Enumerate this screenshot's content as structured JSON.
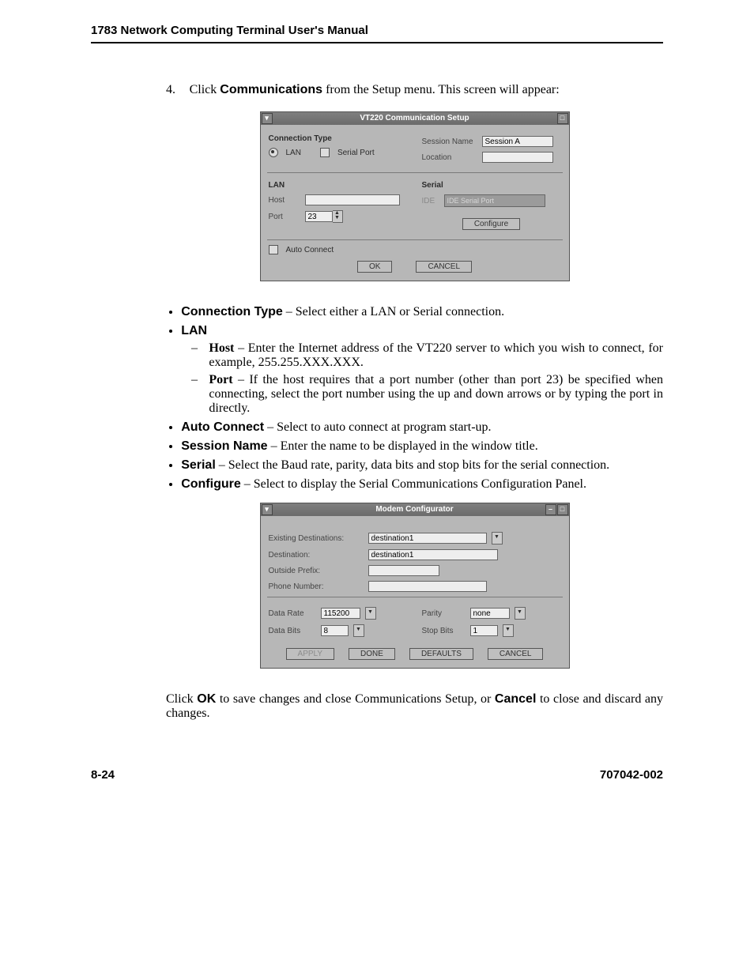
{
  "header": {
    "running": "1783 Network Computing Terminal User's Manual"
  },
  "step": {
    "number": "4.",
    "pre": "Click ",
    "bold": "Communications",
    "post": " from the Setup menu. This screen will appear:"
  },
  "win1": {
    "title": "VT220 Communication Setup",
    "conn_type_label": "Connection Type",
    "radio_lan": "LAN",
    "radio_serial": "Serial Port",
    "session_name_label": "Session Name",
    "session_name_value": "Session A",
    "location_label": "Location",
    "lan_label": "LAN",
    "host_label": "Host",
    "port_label": "Port",
    "port_value": "23",
    "serial_label": "Serial",
    "serial_field_label": "IDE",
    "serial_field_value": "IDE Serial Port",
    "configure_btn": "Configure",
    "auto_connect": "Auto Connect",
    "ok": "OK",
    "cancel": "CANCEL"
  },
  "bullets": {
    "b1_bold": "Connection Type",
    "b1_rest": " – Select either a LAN or Serial connection.",
    "b2_bold": "LAN",
    "b2a_bold": "Host",
    "b2a_rest": " – Enter the Internet address of the VT220 server to which you wish to connect, for example, 255.255.XXX.XXX.",
    "b2b_bold": "Port",
    "b2b_rest": " – If the host requires that a port number (other than port 23) be specified when connecting, select the port number using the up and down arrows or by typing the port in directly.",
    "b3_bold": "Auto Connect",
    "b3_rest": " – Select to auto connect at program start-up.",
    "b4_bold": "Session Name",
    "b4_rest": " – Enter the name to be displayed in the window title.",
    "b5_bold": "Serial",
    "b5_rest": " – Select the Baud rate, parity, data bits and stop bits for the serial connection.",
    "b6_bold": "Configure",
    "b6_rest": " – Select to display the Serial Communications Configuration Panel."
  },
  "win2": {
    "title": "Modem Configurator",
    "existing_label": "Existing Destinations:",
    "existing_value": "destination1",
    "dest_label": "Destination:",
    "dest_value": "destination1",
    "prefix_label": "Outside Prefix:",
    "phone_label": "Phone Number:",
    "data_rate_label": "Data Rate",
    "data_rate_value": "115200",
    "parity_label": "Parity",
    "parity_value": "none",
    "data_bits_label": "Data Bits",
    "data_bits_value": "8",
    "stop_bits_label": "Stop Bits",
    "stop_bits_value": "1",
    "apply": "APPLY",
    "done": "DONE",
    "defaults": "DEFAULTS",
    "cancel": "CANCEL"
  },
  "closing": {
    "pre": "Click ",
    "b1": "OK",
    "mid": " to save changes and close Communications Setup, or ",
    "b2": "Cancel",
    "post": " to close and discard any changes."
  },
  "footer": {
    "left": "8-24",
    "right": "707042-002"
  }
}
